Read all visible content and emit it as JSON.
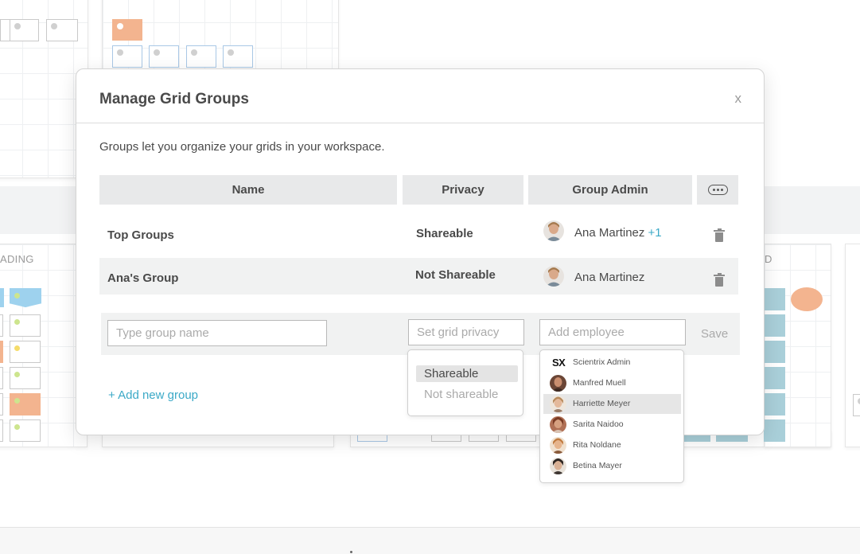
{
  "background": {
    "column_label_left": "ADING",
    "column_label_right": "D"
  },
  "modal": {
    "title": "Manage Grid Groups",
    "close_label": "x",
    "description": "Groups let you organize your grids in your workspace."
  },
  "table": {
    "headers": {
      "name": "Name",
      "privacy": "Privacy",
      "group_admin": "Group Admin",
      "more_icon": "more-horizontal-icon"
    },
    "rows": [
      {
        "name": "Top Groups",
        "privacy": "Shareable",
        "admin": "Ana Martinez",
        "admin_extra": "+1"
      },
      {
        "name": "Ana's Group",
        "privacy": "Not Shareable",
        "admin": "Ana Martinez",
        "admin_extra": ""
      }
    ]
  },
  "new_group": {
    "name_placeholder": "Type group name",
    "privacy_placeholder": "Set grid privacy",
    "employee_placeholder": "Add employee",
    "save_label": "Save",
    "add_link": "+ Add new group"
  },
  "privacy_options": [
    {
      "label": "Shareable",
      "selected": true
    },
    {
      "label": "Not shareable",
      "selected": false
    }
  ],
  "employees": [
    {
      "name": "Scientrix Admin",
      "initials": "SX",
      "avatar_color": "#111111"
    },
    {
      "name": "Manfred Muell",
      "initials": "",
      "avatar_color": "#a0614a"
    },
    {
      "name": "Harriette Meyer",
      "initials": "",
      "avatar_color": "#d8b8a0"
    },
    {
      "name": "Sarita Naidoo",
      "initials": "",
      "avatar_color": "#9a5b3c"
    },
    {
      "name": "Rita Noldane",
      "initials": "",
      "avatar_color": "#c98a5a"
    },
    {
      "name": "Betina Mayer",
      "initials": "",
      "avatar_color": "#5a4638"
    }
  ],
  "colors": {
    "accent": "#3ba9c7",
    "header_bg": "#e8e9ea",
    "row_alt_bg": "#f1f2f2",
    "card_orange": "#f3b48f",
    "card_blue": "#9ed2ee"
  }
}
